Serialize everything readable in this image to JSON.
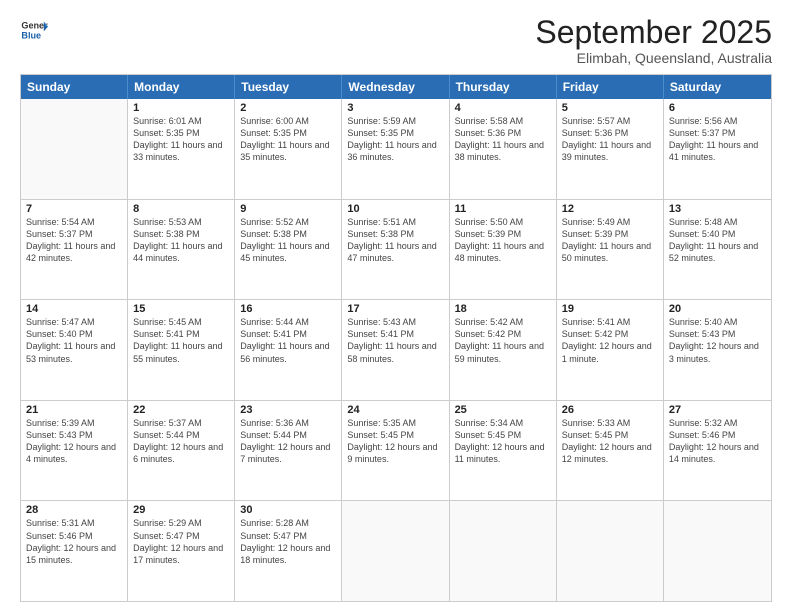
{
  "header": {
    "logo": {
      "line1": "General",
      "line2": "Blue"
    },
    "month_title": "September 2025",
    "location": "Elimbah, Queensland, Australia"
  },
  "weekdays": [
    "Sunday",
    "Monday",
    "Tuesday",
    "Wednesday",
    "Thursday",
    "Friday",
    "Saturday"
  ],
  "rows": [
    [
      {
        "day": "",
        "empty": true
      },
      {
        "day": "1",
        "sunrise": "Sunrise: 6:01 AM",
        "sunset": "Sunset: 5:35 PM",
        "daylight": "Daylight: 11 hours and 33 minutes."
      },
      {
        "day": "2",
        "sunrise": "Sunrise: 6:00 AM",
        "sunset": "Sunset: 5:35 PM",
        "daylight": "Daylight: 11 hours and 35 minutes."
      },
      {
        "day": "3",
        "sunrise": "Sunrise: 5:59 AM",
        "sunset": "Sunset: 5:35 PM",
        "daylight": "Daylight: 11 hours and 36 minutes."
      },
      {
        "day": "4",
        "sunrise": "Sunrise: 5:58 AM",
        "sunset": "Sunset: 5:36 PM",
        "daylight": "Daylight: 11 hours and 38 minutes."
      },
      {
        "day": "5",
        "sunrise": "Sunrise: 5:57 AM",
        "sunset": "Sunset: 5:36 PM",
        "daylight": "Daylight: 11 hours and 39 minutes."
      },
      {
        "day": "6",
        "sunrise": "Sunrise: 5:56 AM",
        "sunset": "Sunset: 5:37 PM",
        "daylight": "Daylight: 11 hours and 41 minutes."
      }
    ],
    [
      {
        "day": "7",
        "sunrise": "Sunrise: 5:54 AM",
        "sunset": "Sunset: 5:37 PM",
        "daylight": "Daylight: 11 hours and 42 minutes."
      },
      {
        "day": "8",
        "sunrise": "Sunrise: 5:53 AM",
        "sunset": "Sunset: 5:38 PM",
        "daylight": "Daylight: 11 hours and 44 minutes."
      },
      {
        "day": "9",
        "sunrise": "Sunrise: 5:52 AM",
        "sunset": "Sunset: 5:38 PM",
        "daylight": "Daylight: 11 hours and 45 minutes."
      },
      {
        "day": "10",
        "sunrise": "Sunrise: 5:51 AM",
        "sunset": "Sunset: 5:38 PM",
        "daylight": "Daylight: 11 hours and 47 minutes."
      },
      {
        "day": "11",
        "sunrise": "Sunrise: 5:50 AM",
        "sunset": "Sunset: 5:39 PM",
        "daylight": "Daylight: 11 hours and 48 minutes."
      },
      {
        "day": "12",
        "sunrise": "Sunrise: 5:49 AM",
        "sunset": "Sunset: 5:39 PM",
        "daylight": "Daylight: 11 hours and 50 minutes."
      },
      {
        "day": "13",
        "sunrise": "Sunrise: 5:48 AM",
        "sunset": "Sunset: 5:40 PM",
        "daylight": "Daylight: 11 hours and 52 minutes."
      }
    ],
    [
      {
        "day": "14",
        "sunrise": "Sunrise: 5:47 AM",
        "sunset": "Sunset: 5:40 PM",
        "daylight": "Daylight: 11 hours and 53 minutes."
      },
      {
        "day": "15",
        "sunrise": "Sunrise: 5:45 AM",
        "sunset": "Sunset: 5:41 PM",
        "daylight": "Daylight: 11 hours and 55 minutes."
      },
      {
        "day": "16",
        "sunrise": "Sunrise: 5:44 AM",
        "sunset": "Sunset: 5:41 PM",
        "daylight": "Daylight: 11 hours and 56 minutes."
      },
      {
        "day": "17",
        "sunrise": "Sunrise: 5:43 AM",
        "sunset": "Sunset: 5:41 PM",
        "daylight": "Daylight: 11 hours and 58 minutes."
      },
      {
        "day": "18",
        "sunrise": "Sunrise: 5:42 AM",
        "sunset": "Sunset: 5:42 PM",
        "daylight": "Daylight: 11 hours and 59 minutes."
      },
      {
        "day": "19",
        "sunrise": "Sunrise: 5:41 AM",
        "sunset": "Sunset: 5:42 PM",
        "daylight": "Daylight: 12 hours and 1 minute."
      },
      {
        "day": "20",
        "sunrise": "Sunrise: 5:40 AM",
        "sunset": "Sunset: 5:43 PM",
        "daylight": "Daylight: 12 hours and 3 minutes."
      }
    ],
    [
      {
        "day": "21",
        "sunrise": "Sunrise: 5:39 AM",
        "sunset": "Sunset: 5:43 PM",
        "daylight": "Daylight: 12 hours and 4 minutes."
      },
      {
        "day": "22",
        "sunrise": "Sunrise: 5:37 AM",
        "sunset": "Sunset: 5:44 PM",
        "daylight": "Daylight: 12 hours and 6 minutes."
      },
      {
        "day": "23",
        "sunrise": "Sunrise: 5:36 AM",
        "sunset": "Sunset: 5:44 PM",
        "daylight": "Daylight: 12 hours and 7 minutes."
      },
      {
        "day": "24",
        "sunrise": "Sunrise: 5:35 AM",
        "sunset": "Sunset: 5:45 PM",
        "daylight": "Daylight: 12 hours and 9 minutes."
      },
      {
        "day": "25",
        "sunrise": "Sunrise: 5:34 AM",
        "sunset": "Sunset: 5:45 PM",
        "daylight": "Daylight: 12 hours and 11 minutes."
      },
      {
        "day": "26",
        "sunrise": "Sunrise: 5:33 AM",
        "sunset": "Sunset: 5:45 PM",
        "daylight": "Daylight: 12 hours and 12 minutes."
      },
      {
        "day": "27",
        "sunrise": "Sunrise: 5:32 AM",
        "sunset": "Sunset: 5:46 PM",
        "daylight": "Daylight: 12 hours and 14 minutes."
      }
    ],
    [
      {
        "day": "28",
        "sunrise": "Sunrise: 5:31 AM",
        "sunset": "Sunset: 5:46 PM",
        "daylight": "Daylight: 12 hours and 15 minutes."
      },
      {
        "day": "29",
        "sunrise": "Sunrise: 5:29 AM",
        "sunset": "Sunset: 5:47 PM",
        "daylight": "Daylight: 12 hours and 17 minutes."
      },
      {
        "day": "30",
        "sunrise": "Sunrise: 5:28 AM",
        "sunset": "Sunset: 5:47 PM",
        "daylight": "Daylight: 12 hours and 18 minutes."
      },
      {
        "day": "",
        "empty": true
      },
      {
        "day": "",
        "empty": true
      },
      {
        "day": "",
        "empty": true
      },
      {
        "day": "",
        "empty": true
      }
    ]
  ]
}
